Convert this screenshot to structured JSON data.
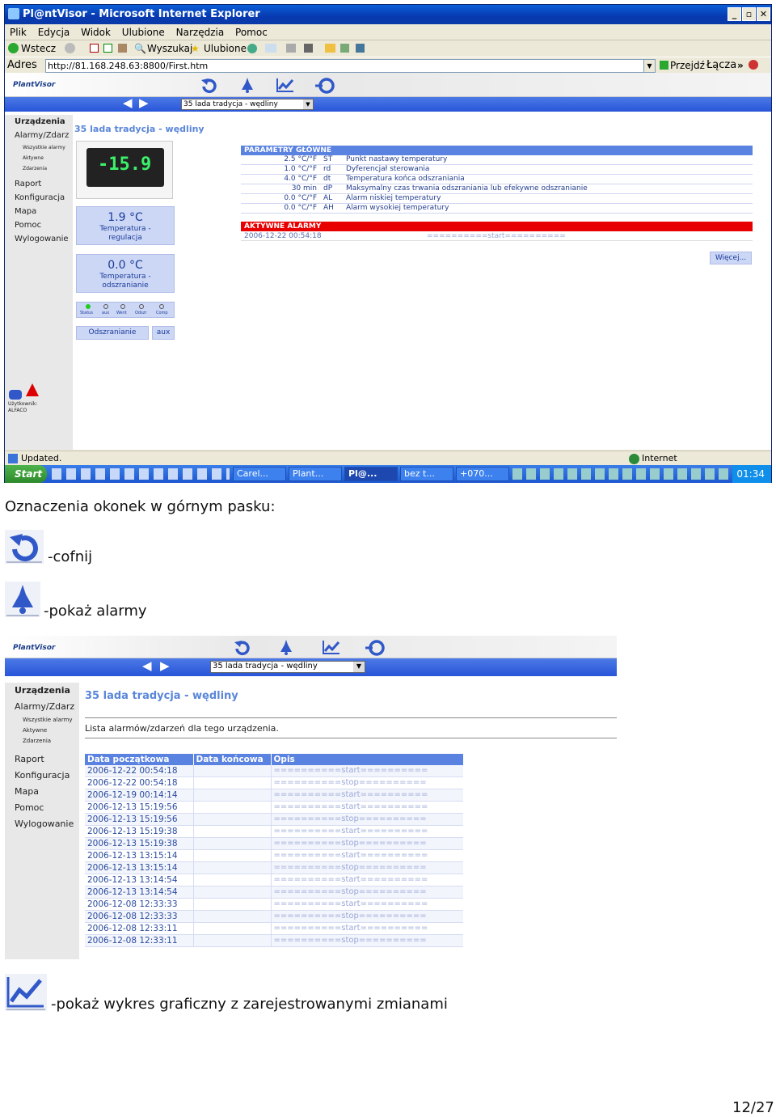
{
  "window": {
    "title": "Pl@ntVisor - Microsoft Internet Explorer",
    "menu": [
      "Plik",
      "Edycja",
      "Widok",
      "Ulubione",
      "Narzędzia",
      "Pomoc"
    ],
    "toolbar": {
      "back": "Wstecz",
      "search": "Wyszukaj",
      "favorites": "Ulubione"
    },
    "address": {
      "label": "Adres",
      "url": "http://81.168.248.63:8800/First.htm",
      "go": "Przejdź",
      "links": "Łącza"
    },
    "status": {
      "text": "Updated.",
      "zone": "Internet"
    },
    "taskbar": {
      "start": "Start",
      "tasks": [
        "Carel...",
        "Plant...",
        "Pl@...",
        "bez t...",
        "+070..."
      ],
      "clock": "01:34"
    }
  },
  "plantvisor": {
    "logo": "PlantVisor",
    "device_select": "35 lada tradycja - wędliny",
    "sidebar": [
      "Urządzenia",
      "Alarmy/Zdarz",
      "Wszystkie alarmy",
      "Aktywne",
      "Zdarzenia",
      "Raport",
      "Konfiguracja",
      "Mapa",
      "Pomoc",
      "Wylogowanie"
    ],
    "user": {
      "label": "Użytkownik:",
      "name": "ALFACO"
    },
    "device_title": "35 lada tradycja - wędliny",
    "display_value": "-15.9",
    "temp_regulation": {
      "value": "1.9 °C",
      "label": "Temperatura - regulacja"
    },
    "temp_defrost": {
      "value": "0.0 °C",
      "label": "Temperatura - odszranianie"
    },
    "status_leds": [
      "Status",
      "aux",
      "Went",
      "Odszr",
      "Comp"
    ],
    "buttons": {
      "defrost": "Odszranianie",
      "aux": "aux",
      "more": "Więcej..."
    },
    "main_params": {
      "header": "PARAMETRY GŁÓWNE",
      "rows": [
        {
          "value": "2.5 °C/°F",
          "code": "ST",
          "desc": "Punkt nastawy temperatury"
        },
        {
          "value": "1.0 °C/°F",
          "code": "rd",
          "desc": "Dyferencjał sterowania"
        },
        {
          "value": "4.0 °C/°F",
          "code": "dt",
          "desc": "Temperatura końca odszraniania"
        },
        {
          "value": "30 min",
          "code": "dP",
          "desc": "Maksymalny czas trwania odszraniania lub efekywne odszranianie"
        },
        {
          "value": "0.0 °C/°F",
          "code": "AL",
          "desc": "Alarm niskiej temperatury"
        },
        {
          "value": "0.0 °C/°F",
          "code": "AH",
          "desc": "Alarm wysokiej temperatury"
        }
      ]
    },
    "active_alarms": {
      "header": "AKTYWNE ALARMY",
      "row": {
        "date": "2006-12-22 00:54:18",
        "desc": "==========start=========="
      }
    }
  },
  "doc": {
    "heading": "Oznaczenia okonek w górnym pasku:",
    "item_back": "-cofnij",
    "item_alarms": "-pokaż alarmy",
    "item_chart": "-pokaż wykres graficzny z zarejestrowanymi zmianami",
    "page_number": "12/27"
  },
  "alarms_view": {
    "title": "35 lada tradycja - wędliny",
    "subtitle": "Lista alarmów/zdarzeń dla tego urządzenia.",
    "columns": [
      "Data początkowa",
      "Data końcowa",
      "Opis"
    ],
    "rows": [
      {
        "start": "2006-12-22 00:54:18",
        "desc": "==========start=========="
      },
      {
        "start": "2006-12-22 00:54:18",
        "desc": "==========stop=========="
      },
      {
        "start": "2006-12-19 00:14:14",
        "desc": "==========start=========="
      },
      {
        "start": "2006-12-13 15:19:56",
        "desc": "==========start=========="
      },
      {
        "start": "2006-12-13 15:19:56",
        "desc": "==========stop=========="
      },
      {
        "start": "2006-12-13 15:19:38",
        "desc": "==========start=========="
      },
      {
        "start": "2006-12-13 15:19:38",
        "desc": "==========stop=========="
      },
      {
        "start": "2006-12-13 13:15:14",
        "desc": "==========start=========="
      },
      {
        "start": "2006-12-13 13:15:14",
        "desc": "==========stop=========="
      },
      {
        "start": "2006-12-13 13:14:54",
        "desc": "==========start=========="
      },
      {
        "start": "2006-12-13 13:14:54",
        "desc": "==========stop=========="
      },
      {
        "start": "2006-12-08 12:33:33",
        "desc": "==========start=========="
      },
      {
        "start": "2006-12-08 12:33:33",
        "desc": "==========stop=========="
      },
      {
        "start": "2006-12-08 12:33:11",
        "desc": "==========start=========="
      },
      {
        "start": "2006-12-08 12:33:11",
        "desc": "==========stop=========="
      }
    ]
  },
  "colors": {
    "accent": "#2755d8",
    "alarm_red": "#e80000",
    "panel": "#ccd6f5",
    "title_blue": "#5a86d8"
  },
  "icons": [
    "back-icon",
    "alarm-bell-icon",
    "chart-icon",
    "refresh-icon"
  ]
}
